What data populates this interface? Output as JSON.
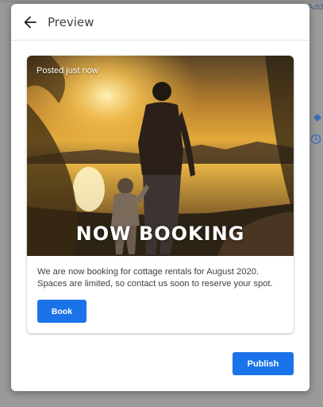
{
  "background": {
    "partial_label": "Add"
  },
  "dialog": {
    "title": "Preview",
    "back_icon": "arrow-left-icon"
  },
  "post": {
    "posted_label": "Posted just now",
    "overlay_text": "NOW BOOKING",
    "body_text": "We are now booking for cottage rentals for August 2020. Spaces are limited, so contact us soon to reserve your spot.",
    "button_label": "Book"
  },
  "footer": {
    "publish_label": "Publish"
  },
  "colors": {
    "accent": "#1a73e8",
    "scrim": "#9b9b9b",
    "text": "#3c4043"
  }
}
